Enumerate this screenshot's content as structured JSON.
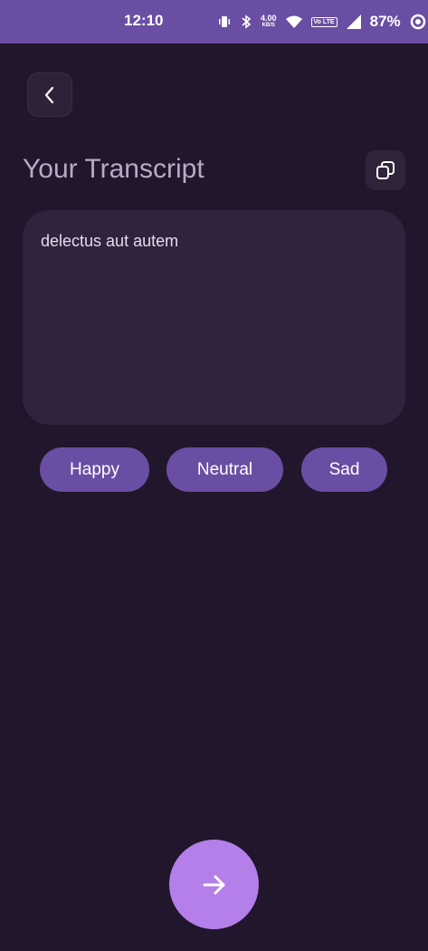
{
  "status_bar": {
    "time": "12:10",
    "network_speed_value": "4.00",
    "network_speed_unit": "KB/S",
    "volte_label": "Vo LTE",
    "battery": "87%",
    "icons": [
      "vibrate-icon",
      "bluetooth-icon",
      "wifi-icon",
      "signal-icon",
      "battery-ring-icon"
    ]
  },
  "header": {
    "back_icon": "chevron-left-icon",
    "title": "Your Transcript",
    "copy_icon": "copy-icon"
  },
  "transcript": {
    "text": "delectus aut autem"
  },
  "moods": [
    {
      "label": "Happy"
    },
    {
      "label": "Neutral"
    },
    {
      "label": "Sad"
    }
  ],
  "next_icon": "arrow-right-icon",
  "colors": {
    "background": "#21162b",
    "status_bar": "#6a4ea3",
    "chip": "#6a4ea3",
    "fab": "#b47fe9",
    "card": "#30233e"
  }
}
